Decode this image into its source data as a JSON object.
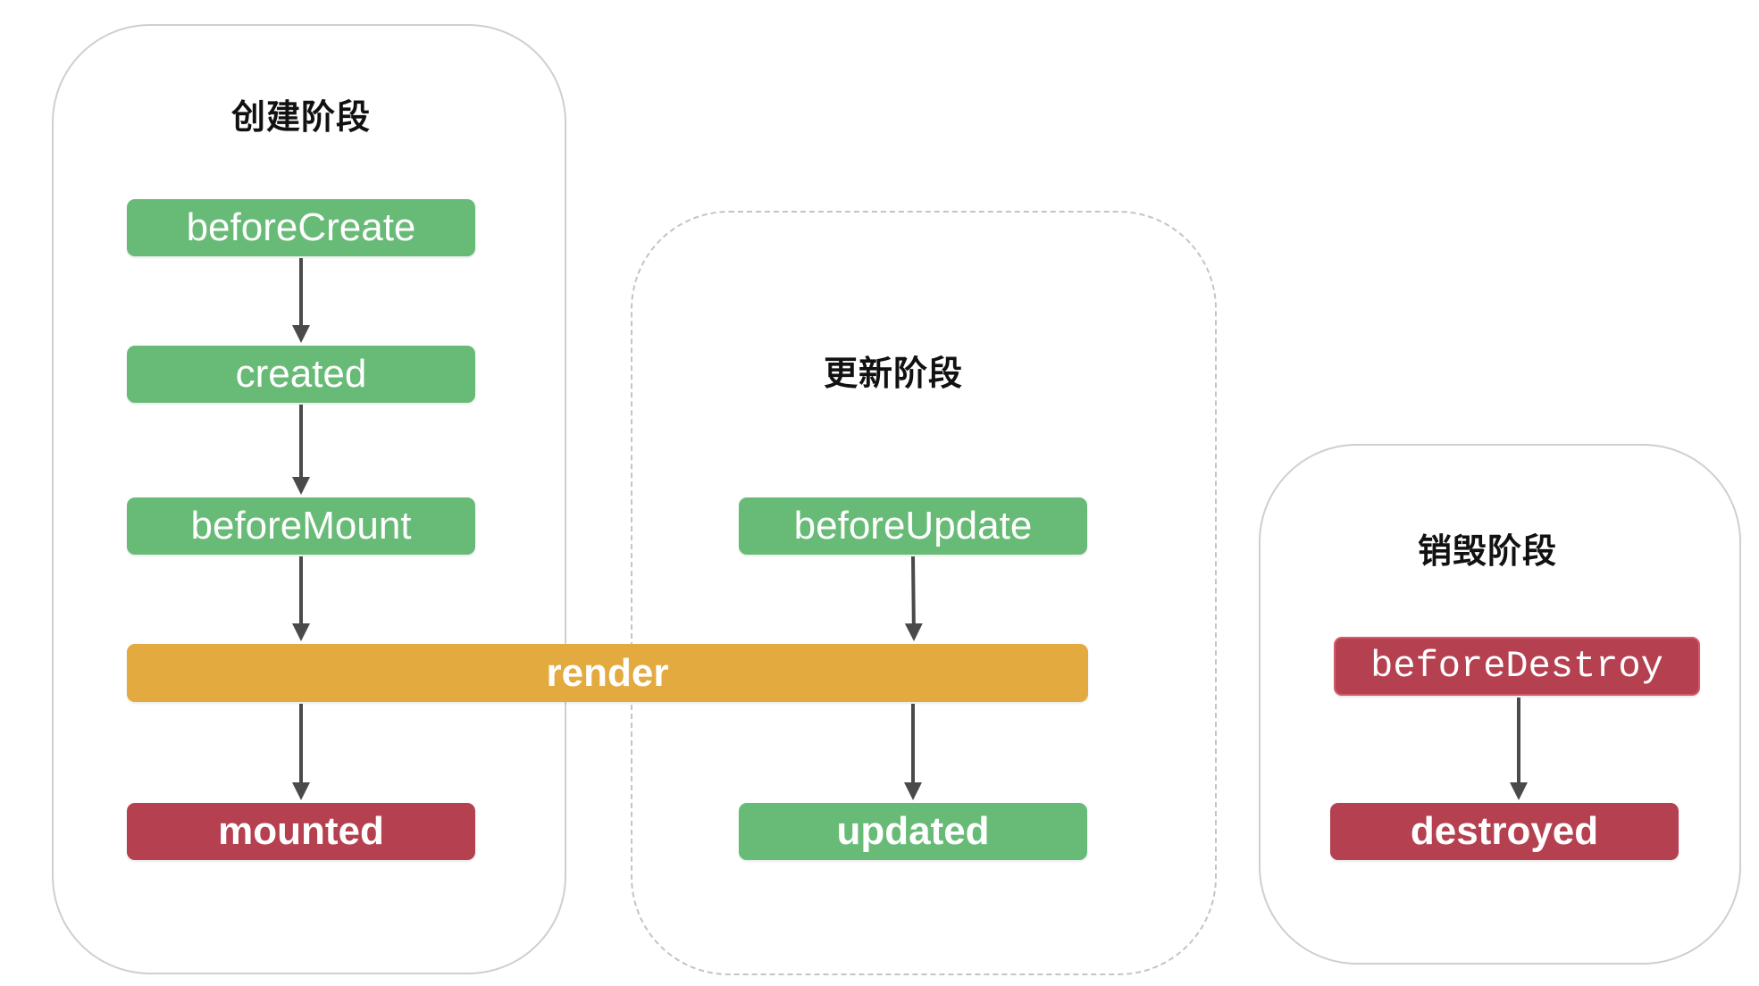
{
  "phases": {
    "create": {
      "title": "创建阶段"
    },
    "update": {
      "title": "更新阶段"
    },
    "destroy": {
      "title": "销毁阶段"
    }
  },
  "nodes": {
    "beforeCreate": "beforeCreate",
    "created": "created",
    "beforeMount": "beforeMount",
    "render": "render",
    "mounted": "mounted",
    "beforeUpdate": "beforeUpdate",
    "updated": "updated",
    "beforeDestroy": "beforeDestroy",
    "destroyed": "destroyed"
  },
  "colors": {
    "green": "#67bb77",
    "red": "#b5404f",
    "gold": "#e3aa3f",
    "arrow": "#4a4a4a",
    "panel_border": "#cfcfcf"
  },
  "edges": [
    {
      "from": "beforeCreate",
      "to": "created"
    },
    {
      "from": "created",
      "to": "beforeMount"
    },
    {
      "from": "beforeMount",
      "to": "render"
    },
    {
      "from": "render",
      "to": "mounted"
    },
    {
      "from": "beforeUpdate",
      "to": "render"
    },
    {
      "from": "render",
      "to": "updated"
    },
    {
      "from": "beforeDestroy",
      "to": "destroyed"
    }
  ]
}
